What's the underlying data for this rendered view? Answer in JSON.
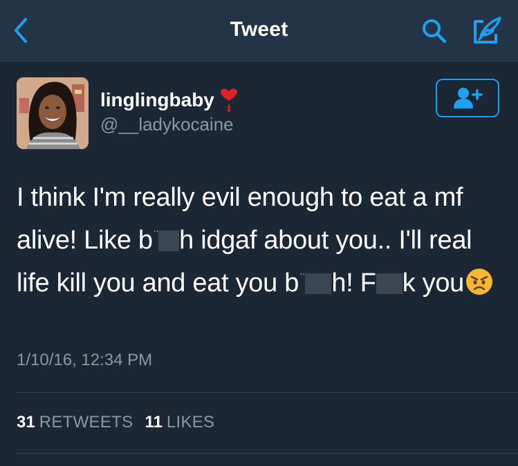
{
  "nav": {
    "title": "Tweet",
    "back_icon": "chevron-left-icon",
    "search_icon": "search-icon",
    "compose_icon": "compose-tweet-icon",
    "accent_color": "#1da1f2"
  },
  "author": {
    "display_name": "linglingbaby",
    "name_emoji": "heavy-heart-exclamation-icon",
    "handle": "@__ladykocaine",
    "avatar": "profile-photo-avatar",
    "follow_icon": "add-user-icon"
  },
  "tweet": {
    "segments": {
      "s1": "I think I'm really evil enough to eat a mf alive! Like b",
      "s2": "h idgaf about you.. I'll real life kill you and eat you b",
      "s3": "h! F",
      "s4": "k you"
    },
    "emoji": "angry-face-icon",
    "timestamp": "1/10/16, 12:34 PM"
  },
  "stats": {
    "retweets_count": "31",
    "retweets_label": "RETWEETS",
    "likes_count": "11",
    "likes_label": "LIKES"
  },
  "colors": {
    "background": "#1b2735",
    "navbar": "#243447",
    "text_primary": "#ffffff",
    "text_secondary": "#8899a6"
  }
}
